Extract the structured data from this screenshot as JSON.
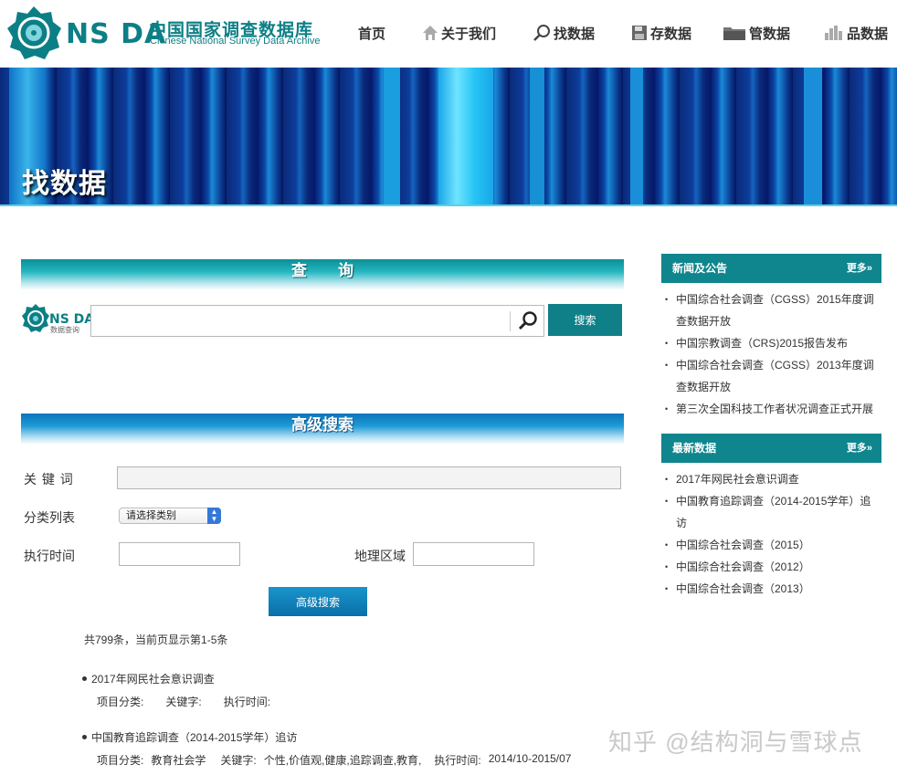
{
  "brand": {
    "letters": "NS DA",
    "cn_name": "中国国家调查数据库",
    "en_name": "Chinese National Survey Data Archive",
    "color": "#0c7f86"
  },
  "nav": [
    {
      "label": "首页",
      "icon": ""
    },
    {
      "label": "关于我们",
      "icon": "house-icon"
    },
    {
      "label": "找数据",
      "icon": "search-icon"
    },
    {
      "label": "存数据",
      "icon": "save-disk-icon"
    },
    {
      "label": "管数据",
      "icon": "folder-icon"
    },
    {
      "label": "品数据",
      "icon": "bar-chart-icon"
    }
  ],
  "banner": {
    "title": "找数据"
  },
  "query": {
    "header": "查　　询",
    "logo_sub": "数据查询",
    "search_button": "搜索",
    "search_value": ""
  },
  "advanced": {
    "header": "高级搜索",
    "keyword_label": "关 键 词",
    "category_label": "分类列表",
    "category_selected": "请选择类别",
    "time_label": "执行时间",
    "region_label": "地理区域",
    "button": "高级搜索"
  },
  "results": {
    "count_text": "共799条，当前页显示第1-5条",
    "items": [
      {
        "title": "2017年网民社会意识调查",
        "category_label": "项目分类:",
        "category": "",
        "keywords_label": "关键字:",
        "keywords": "",
        "time_label": "执行时间:",
        "time": ""
      },
      {
        "title": "中国教育追踪调查（2014-2015学年）追访",
        "category_label": "项目分类:",
        "category": "教育社会学",
        "keywords_label": "关键字:",
        "keywords": "个性,价值观,健康,追踪调查,教育,",
        "time_label": "执行时间:",
        "time": "2014/10-2015/07"
      }
    ]
  },
  "sidebar": {
    "news": {
      "title": "新闻及公告",
      "more": "更多»",
      "items": [
        "中国综合社会调查（CGSS）2015年度调查数据开放",
        "中国宗教调查（CRS)2015报告发布",
        "中国综合社会调查（CGSS）2013年度调查数据开放",
        "第三次全国科技工作者状况调查正式开展"
      ]
    },
    "latest": {
      "title": "最新数据",
      "more": "更多»",
      "items": [
        "2017年网民社会意识调查",
        "中国教育追踪调查（2014-2015学年）追访",
        "中国综合社会调查（2015）",
        "中国综合社会调查（2012）",
        "中国综合社会调查（2013）"
      ]
    }
  },
  "watermark": "知乎 @结构洞与雪球点"
}
